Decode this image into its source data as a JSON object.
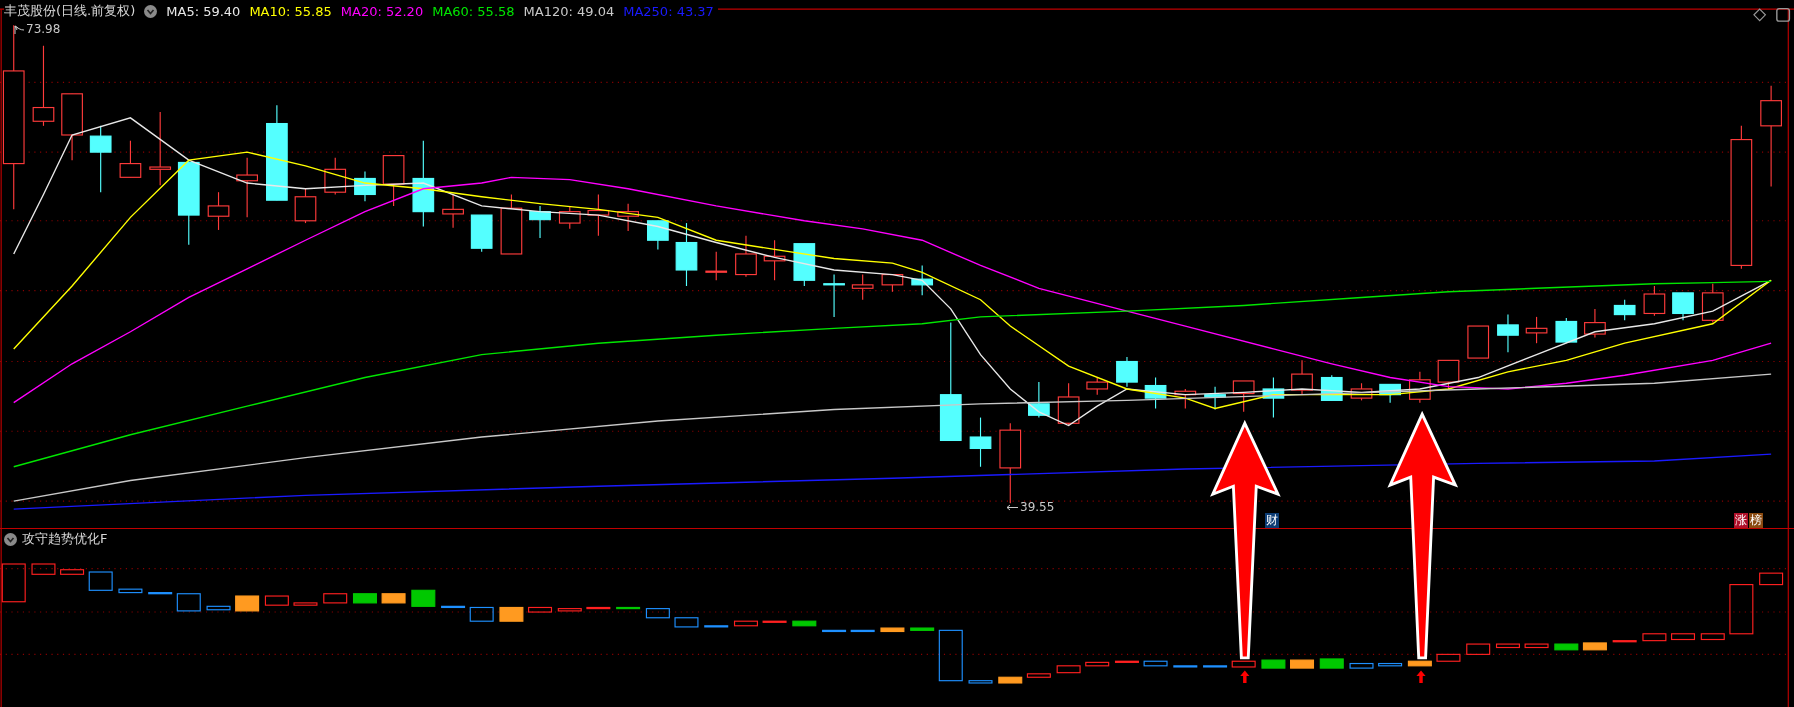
{
  "header": {
    "title": "丰茂股份(日线.前复权)",
    "indicators": [
      {
        "label": "MA5: 59.40",
        "color": "#e8e8e8"
      },
      {
        "label": "MA10: 55.85",
        "color": "#ffff00"
      },
      {
        "label": "MA20: 52.20",
        "color": "#ff00ff"
      },
      {
        "label": "MA60: 55.58",
        "color": "#00e600"
      },
      {
        "label": "MA120: 49.04",
        "color": "#c8c8c8"
      },
      {
        "label": "MA250: 43.37",
        "color": "#1a1aff"
      }
    ]
  },
  "main_chart": {
    "high_label": "73.98",
    "low_label": "39.55",
    "badges": [
      {
        "text": "财",
        "color": "#0b3b73"
      },
      {
        "text": "涨",
        "color": "#b0102a"
      },
      {
        "text": "榜",
        "color": "#8a4a10"
      }
    ]
  },
  "sub_chart": {
    "title": "攻守趋势优化F"
  }
}
